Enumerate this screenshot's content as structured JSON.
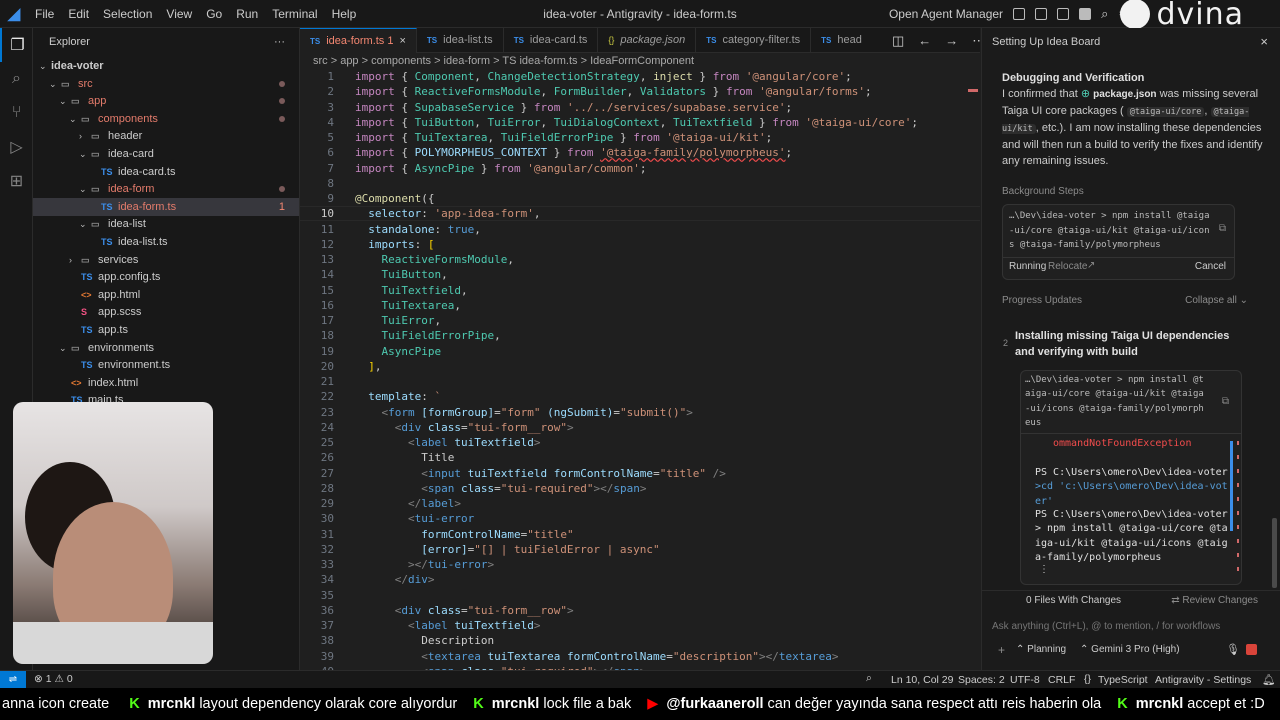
{
  "titlebar": {
    "menu": [
      "File",
      "Edit",
      "Selection",
      "View",
      "Go",
      "Run",
      "Terminal",
      "Help"
    ],
    "title": "idea-voter - Antigravity - idea-form.ts",
    "open_agent_manager": "Open Agent Manager",
    "brand": "dvina"
  },
  "explorer": {
    "header": "Explorer",
    "more": "···",
    "tree": [
      {
        "label": "idea-voter",
        "indent": 0,
        "chev": "v",
        "icon": "",
        "color": "#cccccc"
      },
      {
        "label": "src",
        "indent": 1,
        "chev": "v",
        "icon": "folder",
        "color": "#e37b6b",
        "dot": true
      },
      {
        "label": "app",
        "indent": 2,
        "chev": "v",
        "icon": "folder",
        "color": "#e37b6b",
        "dot": true
      },
      {
        "label": "components",
        "indent": 3,
        "chev": "v",
        "icon": "folder",
        "color": "#e37b6b",
        "dot": true
      },
      {
        "label": "header",
        "indent": 4,
        "chev": ">",
        "icon": "folder",
        "color": "#cccccc"
      },
      {
        "label": "idea-card",
        "indent": 4,
        "chev": "v",
        "icon": "folder",
        "color": "#cccccc"
      },
      {
        "label": "idea-card.ts",
        "indent": 5,
        "chev": "",
        "icon": "TS",
        "color": "#cccccc"
      },
      {
        "label": "idea-form",
        "indent": 4,
        "chev": "v",
        "icon": "folder",
        "color": "#e37b6b",
        "dot": true
      },
      {
        "label": "idea-form.ts",
        "indent": 5,
        "chev": "",
        "icon": "TS",
        "color": "#e37b6b",
        "count": "1",
        "selected": true
      },
      {
        "label": "idea-list",
        "indent": 4,
        "chev": "v",
        "icon": "folder",
        "color": "#cccccc"
      },
      {
        "label": "idea-list.ts",
        "indent": 5,
        "chev": "",
        "icon": "TS",
        "color": "#cccccc"
      },
      {
        "label": "services",
        "indent": 3,
        "chev": ">",
        "icon": "folder",
        "color": "#cccccc"
      },
      {
        "label": "app.config.ts",
        "indent": 3,
        "chev": "",
        "icon": "TS",
        "color": "#cccccc"
      },
      {
        "label": "app.html",
        "indent": 3,
        "chev": "",
        "icon": "<>",
        "color": "#cccccc"
      },
      {
        "label": "app.scss",
        "indent": 3,
        "chev": "",
        "icon": "S",
        "color": "#cccccc"
      },
      {
        "label": "app.ts",
        "indent": 3,
        "chev": "",
        "icon": "TS",
        "color": "#cccccc"
      },
      {
        "label": "environments",
        "indent": 2,
        "chev": "v",
        "icon": "folder",
        "color": "#cccccc"
      },
      {
        "label": "environment.ts",
        "indent": 3,
        "chev": "",
        "icon": "TS",
        "color": "#cccccc"
      },
      {
        "label": "index.html",
        "indent": 2,
        "chev": "",
        "icon": "<>",
        "color": "#cccccc"
      },
      {
        "label": "main.ts",
        "indent": 2,
        "chev": "",
        "icon": "TS",
        "color": "#cccccc"
      }
    ]
  },
  "tabs": [
    {
      "label": "idea-form.ts 1",
      "icon": "TS",
      "active": true,
      "close": "×"
    },
    {
      "label": "idea-list.ts",
      "icon": "TS"
    },
    {
      "label": "idea-card.ts",
      "icon": "TS"
    },
    {
      "label": "package.json",
      "icon": "{}"
    },
    {
      "label": "category-filter.ts",
      "icon": "TS"
    },
    {
      "label": "head",
      "icon": "TS"
    }
  ],
  "breadcrumb": "src > app > components > idea-form > TS idea-form.ts > IdeaFormComponent",
  "code": [
    {
      "n": "1",
      "h": "<span class='k'>import</span> { <span class='t'>Component</span>, <span class='t'>ChangeDetectionStrategy</span>, <span class='d'>inject</span> } <span class='k'>from</span> <span class='s'>'@angular/core'</span>;"
    },
    {
      "n": "2",
      "h": "<span class='k'>import</span> { <span class='t'>ReactiveFormsModule</span>, <span class='t'>FormBuilder</span>, <span class='t'>Validators</span> } <span class='k'>from</span> <span class='s'>'@angular/forms'</span>;"
    },
    {
      "n": "3",
      "h": "<span class='k'>import</span> { <span class='t'>SupabaseService</span> } <span class='k'>from</span> <span class='s'>'../../services/supabase.service'</span>;"
    },
    {
      "n": "4",
      "h": "<span class='k'>import</span> { <span class='t'>TuiButton</span>, <span class='t'>TuiError</span>, <span class='t'>TuiDialogContext</span>, <span class='t'>TuiTextfield</span> } <span class='k'>from</span> <span class='s'>'@taiga-ui/core'</span>;"
    },
    {
      "n": "5",
      "h": "<span class='k'>import</span> { <span class='t'>TuiTextarea</span>, <span class='t'>TuiFieldErrorPipe</span> } <span class='k'>from</span> <span class='s'>'@taiga-ui/kit'</span>;"
    },
    {
      "n": "6",
      "h": "<span class='k'>import</span> { <span class='v'>POLYMORPHEUS_CONTEXT</span> } <span class='k'>from</span> <span class='s' style='text-decoration:underline wavy #f14c4c'>'@taiga-family/polymorpheus'</span>;"
    },
    {
      "n": "7",
      "h": "<span class='k'>import</span> { <span class='t'>AsyncPipe</span> } <span class='k'>from</span> <span class='s'>'@angular/common'</span>;"
    },
    {
      "n": "8",
      "h": ""
    },
    {
      "n": "9",
      "h": "<span class='d'>@Component</span>({"
    },
    {
      "n": "10",
      "h": "  <span class='v'>selector</span>: <span class='s'>'app-idea-form'</span>,",
      "cur": true
    },
    {
      "n": "11",
      "h": "  <span class='v'>standalone</span>: <span class='b'>true</span>,"
    },
    {
      "n": "12",
      "h": "  <span class='v'>imports</span>: <span class='y'>[</span>"
    },
    {
      "n": "13",
      "h": "    <span class='t'>ReactiveFormsModule</span>,"
    },
    {
      "n": "14",
      "h": "    <span class='t'>TuiButton</span>,"
    },
    {
      "n": "15",
      "h": "    <span class='t'>TuiTextfield</span>,"
    },
    {
      "n": "16",
      "h": "    <span class='t'>TuiTextarea</span>,"
    },
    {
      "n": "17",
      "h": "    <span class='t'>TuiError</span>,"
    },
    {
      "n": "18",
      "h": "    <span class='t'>TuiFieldErrorPipe</span>,"
    },
    {
      "n": "19",
      "h": "    <span class='t'>AsyncPipe</span>"
    },
    {
      "n": "20",
      "h": "  <span class='y'>]</span>,"
    },
    {
      "n": "21",
      "h": ""
    },
    {
      "n": "22",
      "h": "  <span class='v'>template</span>: <span class='s'>`</span>"
    },
    {
      "n": "23",
      "h": "    <span class='g'>&lt;</span><span class='b'>form</span> <span class='v'>[formGroup]</span>=<span class='s'>\"form\"</span> <span class='v'>(ngSubmit)</span>=<span class='s'>\"submit()\"</span><span class='g'>&gt;</span>"
    },
    {
      "n": "24",
      "h": "      <span class='g'>&lt;</span><span class='b'>div</span> <span class='v'>class</span>=<span class='s'>\"tui-form__row\"</span><span class='g'>&gt;</span>"
    },
    {
      "n": "25",
      "h": "        <span class='g'>&lt;</span><span class='b'>label</span> <span class='v'>tuiTextfield</span><span class='g'>&gt;</span>"
    },
    {
      "n": "26",
      "h": "          Title"
    },
    {
      "n": "27",
      "h": "          <span class='g'>&lt;</span><span class='b'>input</span> <span class='v'>tuiTextfield</span> <span class='v'>formControlName</span>=<span class='s'>\"title\"</span> <span class='g'>/&gt;</span>"
    },
    {
      "n": "28",
      "h": "          <span class='g'>&lt;</span><span class='b'>span</span> <span class='v'>class</span>=<span class='s'>\"tui-required\"</span><span class='g'>&gt;&lt;/</span><span class='b'>span</span><span class='g'>&gt;</span>"
    },
    {
      "n": "29",
      "h": "        <span class='g'>&lt;/</span><span class='b'>label</span><span class='g'>&gt;</span>"
    },
    {
      "n": "30",
      "h": "        <span class='g'>&lt;</span><span class='b'>tui-error</span>"
    },
    {
      "n": "31",
      "h": "          <span class='v'>formControlName</span>=<span class='s'>\"title\"</span>"
    },
    {
      "n": "32",
      "h": "          <span class='v'>[error]</span>=<span class='s'>\"[] | tuiFieldError | async\"</span>"
    },
    {
      "n": "33",
      "h": "        <span class='g'>&gt;&lt;/</span><span class='b'>tui-error</span><span class='g'>&gt;</span>"
    },
    {
      "n": "34",
      "h": "      <span class='g'>&lt;/</span><span class='b'>div</span><span class='g'>&gt;</span>"
    },
    {
      "n": "35",
      "h": ""
    },
    {
      "n": "36",
      "h": "      <span class='g'>&lt;</span><span class='b'>div</span> <span class='v'>class</span>=<span class='s'>\"tui-form__row\"</span><span class='g'>&gt;</span>"
    },
    {
      "n": "37",
      "h": "        <span class='g'>&lt;</span><span class='b'>label</span> <span class='v'>tuiTextfield</span><span class='g'>&gt;</span>"
    },
    {
      "n": "38",
      "h": "          Description"
    },
    {
      "n": "39",
      "h": "          <span class='g'>&lt;</span><span class='b'>textarea</span> <span class='v'>tuiTextarea</span> <span class='v'>formControlName</span>=<span class='s'>\"description\"</span><span class='g'>&gt;&lt;/</span><span class='b'>textarea</span><span class='g'>&gt;</span>"
    },
    {
      "n": "40",
      "h": "          <span class='g'>&lt;</span><span class='b'>span</span> <span class='v'>class</span>=<span class='s'>\"tui-required\"</span><span class='g'>&gt;&lt;/</span><span class='b'>span</span><span class='g'>&gt;</span>"
    }
  ],
  "agent": {
    "panel_title": "Setting Up Idea Board",
    "section_title": "Debugging and Verification",
    "para_pre": "I confirmed that",
    "file_chip": "package.json",
    "para_mid": "was missing several Taiga UI core packages (",
    "chip1": "@taiga-ui/core",
    "chip2": "@taiga-ui/kit",
    "para_post": ", etc.). I am now installing these dependencies and will then run a build to verify the fixes and identify any remaining issues.",
    "bg_steps": "Background Steps",
    "bg_cmd": "…\\Dev\\idea-voter > npm install @taiga\n-ui/core @taiga-ui/kit @taiga-ui/icon\ns @taiga-family/polymorpheus",
    "running": "Running",
    "relocate": "Relocate",
    "cancel": "Cancel",
    "progress": "Progress Updates",
    "collapse_all": "Collapse all",
    "step_num": "2",
    "step_title": "Installing missing Taiga UI dependencies and verifying with build",
    "step_cmd": "…\\Dev\\idea-voter > npm install @t\naiga-ui/core @taiga-ui/kit @taiga\n-ui/icons @taiga-family/polymorph\neus",
    "err_line": "ommandNotFoundException",
    "ps1": "PS C:\\Users\\omero\\Dev\\idea-voter",
    "cd_cmd": ">cd 'c:\\Users\\omero\\Dev\\idea-vot\ner'",
    "ps2": "PS C:\\Users\\omero\\Dev\\idea-voter",
    "npm_cmd": "> npm install @taiga-ui/core @ta\niga-ui/kit @taiga-ui/icons @taig\na-family/polymorpheus",
    "files_changed": "0 Files With Changes",
    "review": "Review Changes",
    "input_placeholder": "Ask anything (Ctrl+L), @ to mention, / for workflows",
    "mode": "Planning",
    "model": "Gemini 3 Pro (High)"
  },
  "status": {
    "problems": "1",
    "warnings": "0",
    "position": "Ln 10, Col 29",
    "spaces": "Spaces: 2",
    "encoding": "UTF-8",
    "eol": "CRLF",
    "language": "TypeScript",
    "settings": "Antigravity - Settings"
  },
  "ticker": {
    "lead": "anna icon create",
    "items": [
      {
        "platform": "kick",
        "user": "mrcnkl",
        "msg": "layout dependency olarak core alıyordur"
      },
      {
        "platform": "kick",
        "user": "mrcnkl",
        "msg": "lock file a bak"
      },
      {
        "platform": "youtube",
        "user": "@furkaaneroll",
        "msg": "can değer yayında sana respect attı reis haberin ola"
      },
      {
        "platform": "kick",
        "user": "mrcnkl",
        "msg": "accept et :D"
      }
    ]
  }
}
